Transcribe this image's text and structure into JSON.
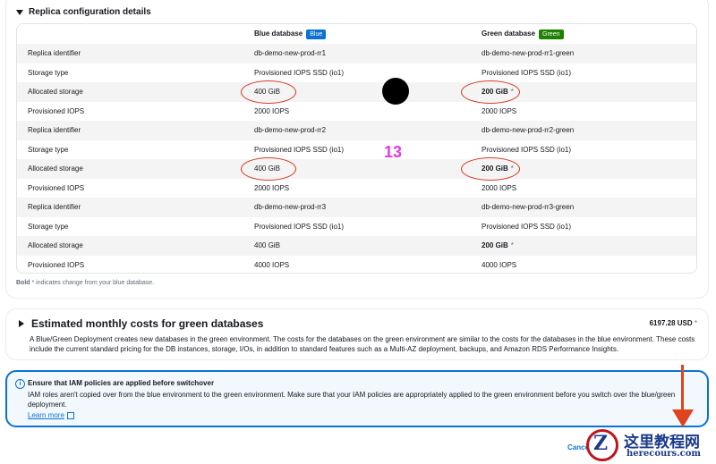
{
  "replica_section": {
    "title": "Replica configuration details",
    "headers": {
      "blue": "Blue database",
      "blue_badge": "Blue",
      "green": "Green database",
      "green_badge": "Green"
    },
    "rows": [
      {
        "label": "Replica identifier",
        "blue": "db-demo-new-prod-rr1",
        "green": "db-demo-new-prod-rr1-green",
        "changed": false
      },
      {
        "label": "Storage type",
        "blue": "Provisioned IOPS SSD (io1)",
        "green": "Provisioned IOPS SSD (io1)",
        "changed": false
      },
      {
        "label": "Allocated storage",
        "blue": "400 GiB",
        "green": "200 GiB",
        "changed": true
      },
      {
        "label": "Provisioned IOPS",
        "blue": "2000 IOPS",
        "green": "2000 IOPS",
        "changed": false
      },
      {
        "label": "Replica identifier",
        "blue": "db-demo-new-prod-rr2",
        "green": "db-demo-new-prod-rr2-green",
        "changed": false
      },
      {
        "label": "Storage type",
        "blue": "Provisioned IOPS SSD (io1)",
        "green": "Provisioned IOPS SSD (io1)",
        "changed": false
      },
      {
        "label": "Allocated storage",
        "blue": "400 GiB",
        "green": "200 GiB",
        "changed": true
      },
      {
        "label": "Provisioned IOPS",
        "blue": "2000 IOPS",
        "green": "2000 IOPS",
        "changed": false
      },
      {
        "label": "Replica identifier",
        "blue": "db-demo-new-prod-rr3",
        "green": "db-demo-new-prod-rr3-green",
        "changed": false
      },
      {
        "label": "Storage type",
        "blue": "Provisioned IOPS SSD (io1)",
        "green": "Provisioned IOPS SSD (io1)",
        "changed": false
      },
      {
        "label": "Allocated storage",
        "blue": "400 GiB",
        "green": "200 GiB",
        "changed": true
      },
      {
        "label": "Provisioned IOPS",
        "blue": "4000 IOPS",
        "green": "4000 IOPS",
        "changed": false
      }
    ],
    "changed_marker": "*",
    "footnote_bold": "Bold",
    "footnote_rest": " * indicates change from your blue database."
  },
  "costs": {
    "title": "Estimated monthly costs for green databases",
    "amount": "6197.28 USD",
    "amount_marker": "*",
    "description": "A Blue/Green Deployment creates new databases in the green environment. The costs for the databases on the green environment are similar to the costs for the databases in the blue environment. These costs include the current standard pricing for the DB instances, storage, I/Os, in addition to standard features such as a Multi-AZ deployment, backups, and Amazon RDS Performance Insights."
  },
  "alert": {
    "icon_glyph": "i",
    "title": "Ensure that IAM policies are applied before switchover",
    "body": "IAM roles aren't copied over from the blue environment to the green environment. Make sure that your IAM policies are appropriately applied to the green environment before you switch over the blue/green deployment.",
    "link": "Learn more"
  },
  "annotation": {
    "number": "13"
  },
  "footer": {
    "cancel_label": "Cancel"
  },
  "watermark": {
    "logo_letter": "Z",
    "text_cn": "这里教程网",
    "text_en": "herecours.com"
  },
  "colors": {
    "accent": "#0972d3",
    "green_badge": "#1d8102",
    "annotation_red": "#d6341a",
    "annotation_magenta": "#e13be0"
  }
}
